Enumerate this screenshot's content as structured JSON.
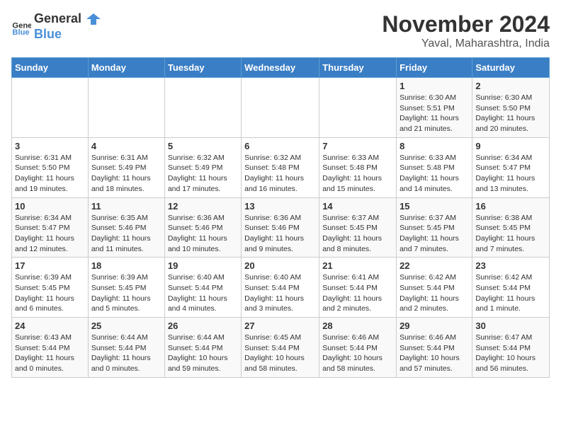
{
  "logo": {
    "general": "General",
    "blue": "Blue"
  },
  "title": "November 2024",
  "location": "Yaval, Maharashtra, India",
  "weekdays": [
    "Sunday",
    "Monday",
    "Tuesday",
    "Wednesday",
    "Thursday",
    "Friday",
    "Saturday"
  ],
  "weeks": [
    [
      {
        "day": "",
        "info": ""
      },
      {
        "day": "",
        "info": ""
      },
      {
        "day": "",
        "info": ""
      },
      {
        "day": "",
        "info": ""
      },
      {
        "day": "",
        "info": ""
      },
      {
        "day": "1",
        "info": "Sunrise: 6:30 AM\nSunset: 5:51 PM\nDaylight: 11 hours and 21 minutes."
      },
      {
        "day": "2",
        "info": "Sunrise: 6:30 AM\nSunset: 5:50 PM\nDaylight: 11 hours and 20 minutes."
      }
    ],
    [
      {
        "day": "3",
        "info": "Sunrise: 6:31 AM\nSunset: 5:50 PM\nDaylight: 11 hours and 19 minutes."
      },
      {
        "day": "4",
        "info": "Sunrise: 6:31 AM\nSunset: 5:49 PM\nDaylight: 11 hours and 18 minutes."
      },
      {
        "day": "5",
        "info": "Sunrise: 6:32 AM\nSunset: 5:49 PM\nDaylight: 11 hours and 17 minutes."
      },
      {
        "day": "6",
        "info": "Sunrise: 6:32 AM\nSunset: 5:48 PM\nDaylight: 11 hours and 16 minutes."
      },
      {
        "day": "7",
        "info": "Sunrise: 6:33 AM\nSunset: 5:48 PM\nDaylight: 11 hours and 15 minutes."
      },
      {
        "day": "8",
        "info": "Sunrise: 6:33 AM\nSunset: 5:48 PM\nDaylight: 11 hours and 14 minutes."
      },
      {
        "day": "9",
        "info": "Sunrise: 6:34 AM\nSunset: 5:47 PM\nDaylight: 11 hours and 13 minutes."
      }
    ],
    [
      {
        "day": "10",
        "info": "Sunrise: 6:34 AM\nSunset: 5:47 PM\nDaylight: 11 hours and 12 minutes."
      },
      {
        "day": "11",
        "info": "Sunrise: 6:35 AM\nSunset: 5:46 PM\nDaylight: 11 hours and 11 minutes."
      },
      {
        "day": "12",
        "info": "Sunrise: 6:36 AM\nSunset: 5:46 PM\nDaylight: 11 hours and 10 minutes."
      },
      {
        "day": "13",
        "info": "Sunrise: 6:36 AM\nSunset: 5:46 PM\nDaylight: 11 hours and 9 minutes."
      },
      {
        "day": "14",
        "info": "Sunrise: 6:37 AM\nSunset: 5:45 PM\nDaylight: 11 hours and 8 minutes."
      },
      {
        "day": "15",
        "info": "Sunrise: 6:37 AM\nSunset: 5:45 PM\nDaylight: 11 hours and 7 minutes."
      },
      {
        "day": "16",
        "info": "Sunrise: 6:38 AM\nSunset: 5:45 PM\nDaylight: 11 hours and 7 minutes."
      }
    ],
    [
      {
        "day": "17",
        "info": "Sunrise: 6:39 AM\nSunset: 5:45 PM\nDaylight: 11 hours and 6 minutes."
      },
      {
        "day": "18",
        "info": "Sunrise: 6:39 AM\nSunset: 5:45 PM\nDaylight: 11 hours and 5 minutes."
      },
      {
        "day": "19",
        "info": "Sunrise: 6:40 AM\nSunset: 5:44 PM\nDaylight: 11 hours and 4 minutes."
      },
      {
        "day": "20",
        "info": "Sunrise: 6:40 AM\nSunset: 5:44 PM\nDaylight: 11 hours and 3 minutes."
      },
      {
        "day": "21",
        "info": "Sunrise: 6:41 AM\nSunset: 5:44 PM\nDaylight: 11 hours and 2 minutes."
      },
      {
        "day": "22",
        "info": "Sunrise: 6:42 AM\nSunset: 5:44 PM\nDaylight: 11 hours and 2 minutes."
      },
      {
        "day": "23",
        "info": "Sunrise: 6:42 AM\nSunset: 5:44 PM\nDaylight: 11 hours and 1 minute."
      }
    ],
    [
      {
        "day": "24",
        "info": "Sunrise: 6:43 AM\nSunset: 5:44 PM\nDaylight: 11 hours and 0 minutes."
      },
      {
        "day": "25",
        "info": "Sunrise: 6:44 AM\nSunset: 5:44 PM\nDaylight: 11 hours and 0 minutes."
      },
      {
        "day": "26",
        "info": "Sunrise: 6:44 AM\nSunset: 5:44 PM\nDaylight: 10 hours and 59 minutes."
      },
      {
        "day": "27",
        "info": "Sunrise: 6:45 AM\nSunset: 5:44 PM\nDaylight: 10 hours and 58 minutes."
      },
      {
        "day": "28",
        "info": "Sunrise: 6:46 AM\nSunset: 5:44 PM\nDaylight: 10 hours and 58 minutes."
      },
      {
        "day": "29",
        "info": "Sunrise: 6:46 AM\nSunset: 5:44 PM\nDaylight: 10 hours and 57 minutes."
      },
      {
        "day": "30",
        "info": "Sunrise: 6:47 AM\nSunset: 5:44 PM\nDaylight: 10 hours and 56 minutes."
      }
    ]
  ]
}
